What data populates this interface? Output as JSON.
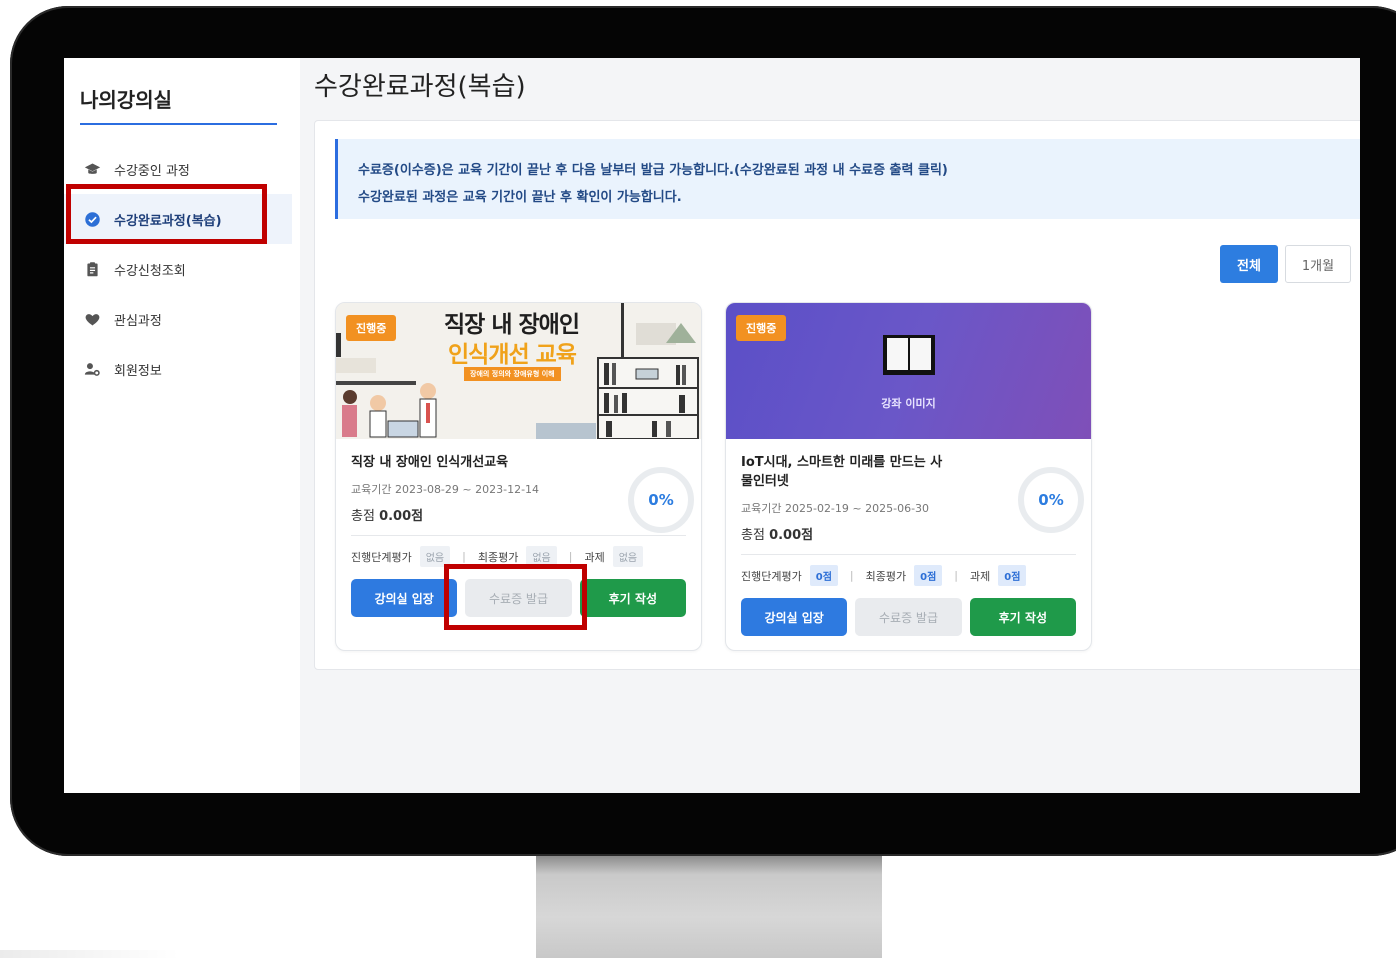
{
  "sidebar": {
    "title": "나의강의실",
    "items": [
      {
        "label": "수강중인 과정"
      },
      {
        "label": "수강완료과정(복습)"
      },
      {
        "label": "수강신청조회"
      },
      {
        "label": "관심과정"
      },
      {
        "label": "회원정보"
      }
    ]
  },
  "page": {
    "title": "수강완료과정(복습)"
  },
  "notice": {
    "line1": "수료증(이수증)은 교육 기간이 끝난 후 다음 날부터 발급 가능합니다.(수강완료된 과정 내 수료증 출력 클릭)",
    "line2": "수강완료된 과정은 교육 기간이 끝난 후 확인이 가능합니다."
  },
  "filters": {
    "all": "전체",
    "one_month": "1개월"
  },
  "courses": [
    {
      "badge": "진행중",
      "thumb_title_1": "직장 내 장애인",
      "thumb_title_2": "인식개선 교육",
      "thumb_subtitle": "장애의 정의와 장애유형 이해",
      "title": "직장 내 장애인 인식개선교육",
      "period": "교육기간 2023-08-29 ~ 2023-12-14",
      "score_label": "총점",
      "score_value": "0.00점",
      "progress": "0%",
      "eval_stage_label": "진행단계평가",
      "eval_stage_value": "없음",
      "eval_final_label": "최종평가",
      "eval_final_value": "없음",
      "eval_task_label": "과제",
      "eval_task_value": "없음",
      "btn_enter": "강의실 입장",
      "btn_cert": "수료증 발급",
      "btn_review": "후기 작성"
    },
    {
      "badge": "진행중",
      "thumb_caption": "강좌 이미지",
      "title": "IoT시대, 스마트한 미래를 만드는 사물인터넷",
      "period": "교육기간 2025-02-19 ~ 2025-06-30",
      "score_label": "총점",
      "score_value": "0.00점",
      "progress": "0%",
      "eval_stage_label": "진행단계평가",
      "eval_stage_value": "0점",
      "eval_final_label": "최종평가",
      "eval_final_value": "0점",
      "eval_task_label": "과제",
      "eval_task_value": "0점",
      "btn_enter": "강의실 입장",
      "btn_cert": "수료증 발급",
      "btn_review": "후기 작성"
    }
  ],
  "colors": {
    "accent": "#2d7de0",
    "badge": "#f29121",
    "review": "#1f9a4a",
    "highlight": "#c00000"
  }
}
